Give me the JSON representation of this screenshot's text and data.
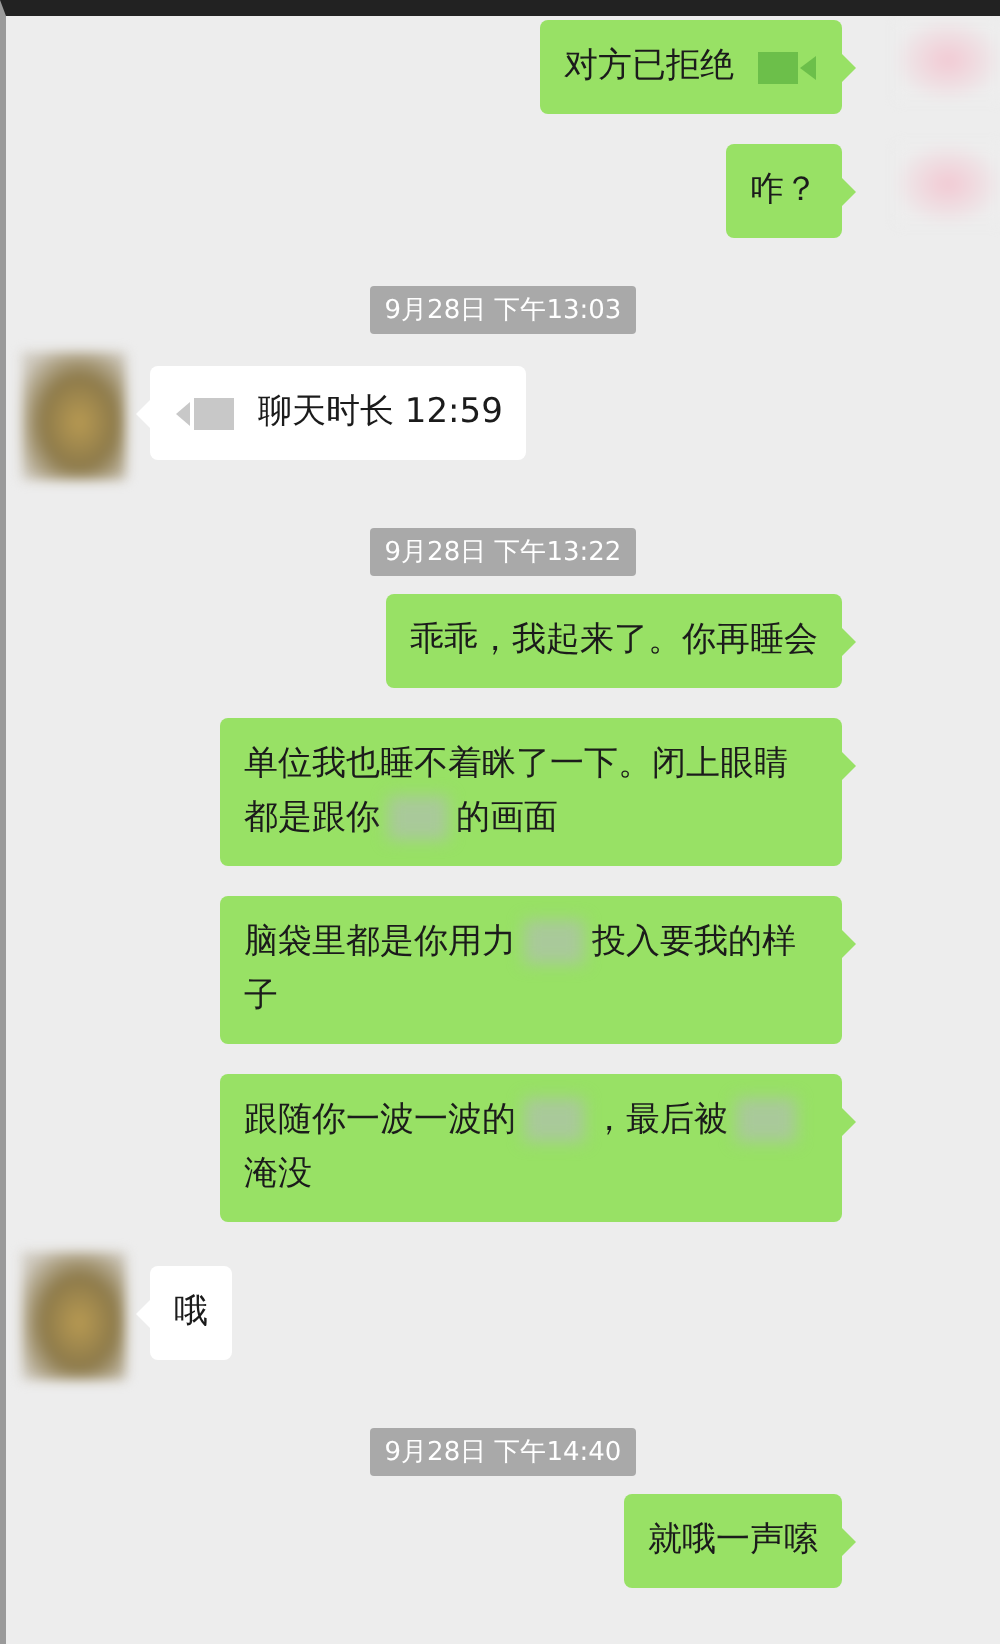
{
  "messages": [
    {
      "kind": "sent",
      "avatar": true,
      "call": true,
      "segments": [
        {
          "kind": "text",
          "text": "对方已拒绝"
        }
      ]
    },
    {
      "kind": "sent",
      "avatar": true,
      "call": false,
      "segments": [
        {
          "kind": "text",
          "text": "咋？"
        }
      ]
    },
    {
      "kind": "time",
      "text": "9月28日 下午13:03"
    },
    {
      "kind": "received",
      "avatar": true,
      "call": true,
      "segments": [
        {
          "kind": "text",
          "text": "聊天时长 12:59"
        }
      ]
    },
    {
      "kind": "time",
      "text": "9月28日 下午13:22"
    },
    {
      "kind": "sent",
      "avatar": false,
      "call": false,
      "segments": [
        {
          "kind": "text",
          "text": "乖乖，我起来了。你再睡会"
        }
      ]
    },
    {
      "kind": "sent",
      "avatar": false,
      "call": false,
      "segments": [
        {
          "kind": "text",
          "text": "单位我也睡不着眯了一下。闭上眼睛都是跟你"
        },
        {
          "kind": "blur"
        },
        {
          "kind": "text",
          "text": "的画面"
        }
      ]
    },
    {
      "kind": "sent",
      "avatar": false,
      "call": false,
      "segments": [
        {
          "kind": "text",
          "text": "脑袋里都是你用力"
        },
        {
          "kind": "blur"
        },
        {
          "kind": "text",
          "text": "投入要我的样子"
        }
      ]
    },
    {
      "kind": "sent",
      "avatar": false,
      "call": false,
      "segments": [
        {
          "kind": "text",
          "text": "跟随你一波一波的"
        },
        {
          "kind": "blur"
        },
        {
          "kind": "text",
          "text": "，最后被"
        },
        {
          "kind": "blur"
        },
        {
          "kind": "text",
          "text": "淹没"
        }
      ]
    },
    {
      "kind": "received",
      "avatar": true,
      "call": false,
      "segments": [
        {
          "kind": "text",
          "text": "哦"
        }
      ]
    },
    {
      "kind": "time",
      "text": "9月28日 下午14:40"
    },
    {
      "kind": "sent",
      "avatar": false,
      "call": false,
      "segments": [
        {
          "kind": "text",
          "text": "就哦一声嗦"
        }
      ]
    }
  ]
}
